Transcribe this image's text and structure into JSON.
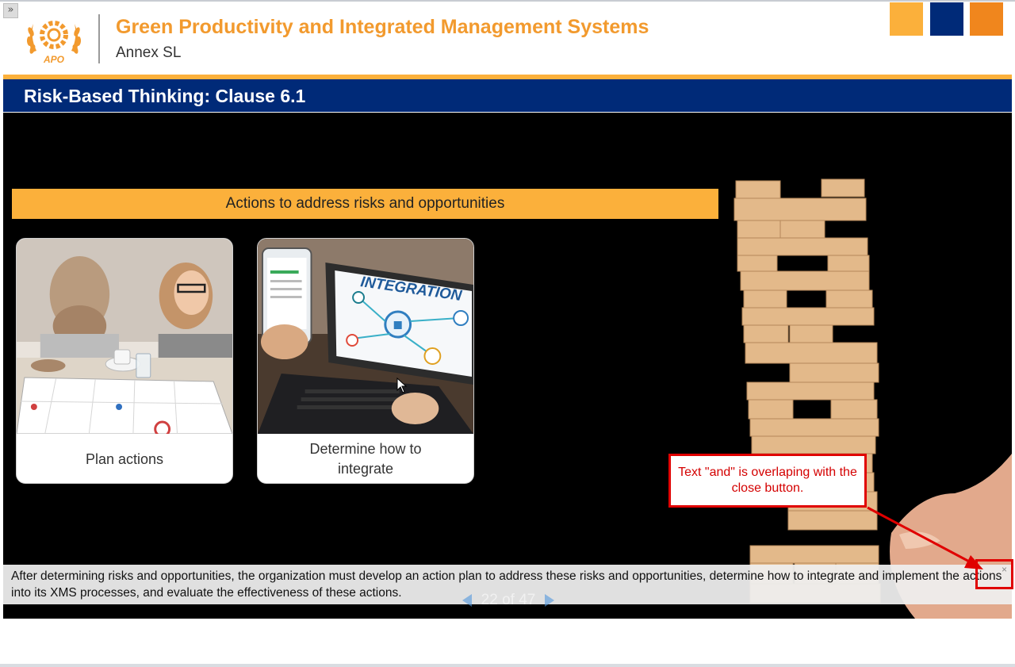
{
  "header": {
    "toggle_glyph": "»",
    "title": "Green Productivity and Integrated Management Systems",
    "subtitle": "Annex SL",
    "logo_text": "APO",
    "accent_colors": [
      "#fbb03b",
      "#002a78",
      "#f0861d"
    ]
  },
  "slide": {
    "title": "Risk-Based Thinking: Clause 6.1",
    "banner": "Actions to address risks and opportunities",
    "cards": [
      {
        "label": "Plan actions",
        "image": "people planning at a table with calendar"
      },
      {
        "label": "Determine how to integrate",
        "image": "laptop showing INTEGRATION graphic",
        "image_text": "INTEGRATION"
      }
    ],
    "side_image": "wooden block tower with hand"
  },
  "caption": {
    "text": "After determining risks and opportunities, the organization must develop an action plan to address these risks and opportunities, determine how to integrate and implement the actions into its XMS processes, and evaluate the effectiveness of these actions.",
    "close_glyph": "×"
  },
  "pager": {
    "label": "22 of 47"
  },
  "annotation": {
    "text": "Text \"and\" is overlaping with the close button.",
    "color": "#e00000"
  }
}
